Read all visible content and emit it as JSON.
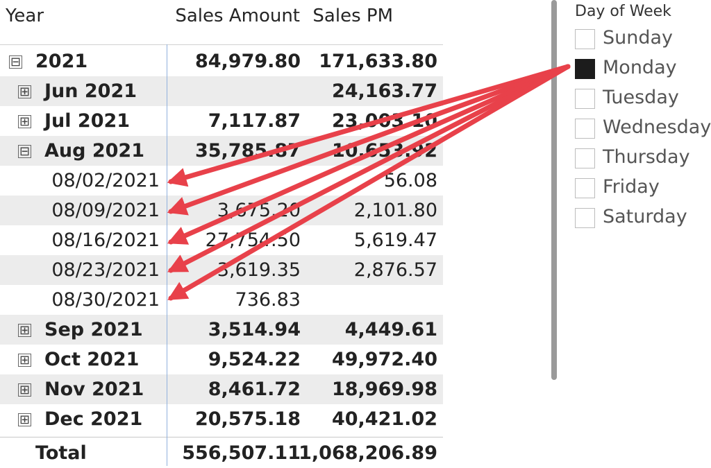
{
  "matrix": {
    "headers": {
      "year": "Year",
      "sales_amount": "Sales Amount",
      "sales_pm": "Sales PM"
    },
    "rows": [
      {
        "label": "2021",
        "toggle": "⊟",
        "sales": "84,979.80",
        "sales_pm": "171,633.80"
      },
      {
        "label": "Jun 2021",
        "toggle": "⊞",
        "sales": "",
        "sales_pm": "24,163.77"
      },
      {
        "label": "Jul 2021",
        "toggle": "⊞",
        "sales": "7,117.87",
        "sales_pm": "23,003.10"
      },
      {
        "label": "Aug 2021",
        "toggle": "⊟",
        "sales": "35,785.87",
        "sales_pm": "10,653.92"
      },
      {
        "label": "08/02/2021",
        "sales": "",
        "sales_pm": "56.08"
      },
      {
        "label": "08/09/2021",
        "sales": "3,675.20",
        "sales_pm": "2,101.80"
      },
      {
        "label": "08/16/2021",
        "sales": "27,754.50",
        "sales_pm": "5,619.47"
      },
      {
        "label": "08/23/2021",
        "sales": "3,619.35",
        "sales_pm": "2,876.57"
      },
      {
        "label": "08/30/2021",
        "sales": "736.83",
        "sales_pm": ""
      },
      {
        "label": "Sep 2021",
        "toggle": "⊞",
        "sales": "3,514.94",
        "sales_pm": "4,449.61"
      },
      {
        "label": "Oct 2021",
        "toggle": "⊞",
        "sales": "9,524.22",
        "sales_pm": "49,972.40"
      },
      {
        "label": "Nov 2021",
        "toggle": "⊞",
        "sales": "8,461.72",
        "sales_pm": "18,969.98"
      },
      {
        "label": "Dec 2021",
        "toggle": "⊞",
        "sales": "20,575.18",
        "sales_pm": "40,421.02"
      }
    ],
    "total": {
      "label": "Total",
      "sales": "556,507.11",
      "sales_pm": "1,068,206.89"
    }
  },
  "slicer": {
    "title": "Day of Week",
    "options": [
      {
        "label": "Sunday",
        "checked": false
      },
      {
        "label": "Monday",
        "checked": true
      },
      {
        "label": "Tuesday",
        "checked": false
      },
      {
        "label": "Wednesday",
        "checked": false
      },
      {
        "label": "Thursday",
        "checked": false
      },
      {
        "label": "Friday",
        "checked": false
      },
      {
        "label": "Saturday",
        "checked": false
      }
    ]
  },
  "colors": {
    "arrow": "#e8414a",
    "row_shade": "#ececec",
    "column_divider": "#8fb0dc",
    "checked_box": "#1c1c1c"
  }
}
